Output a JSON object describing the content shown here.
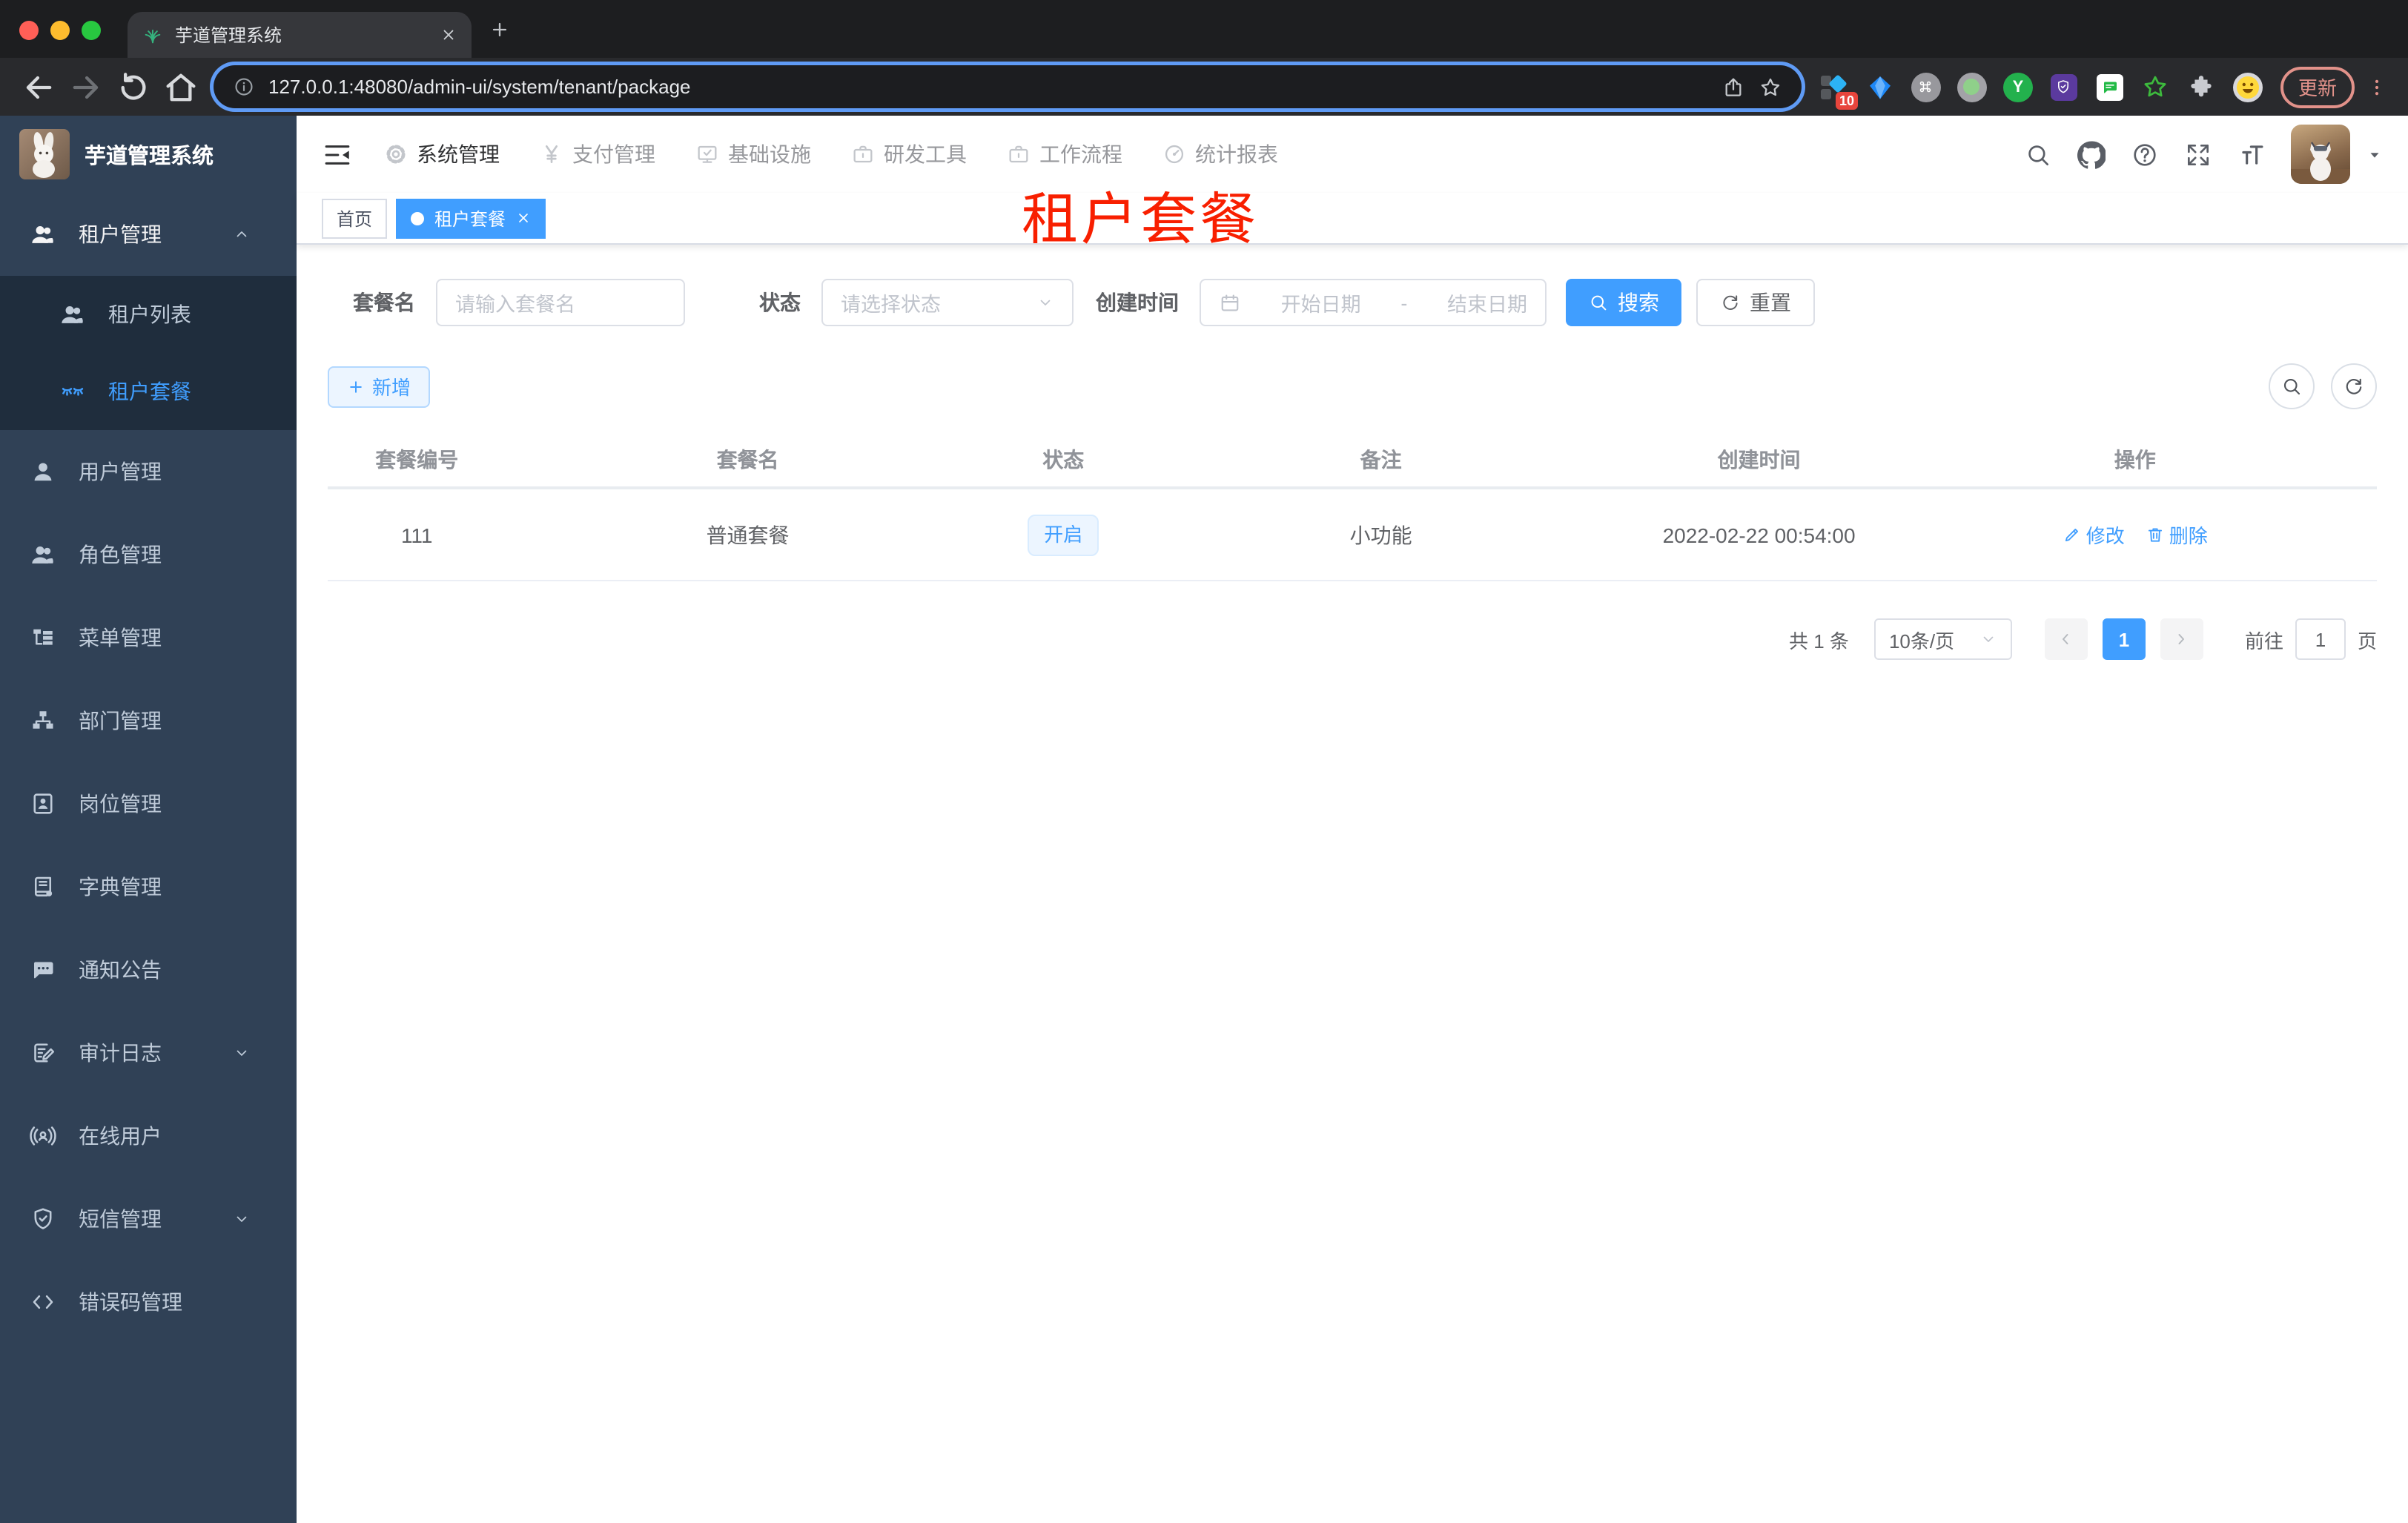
{
  "browser": {
    "tab_title": "芋道管理系统",
    "url": "127.0.0.1:48080/admin-ui/system/tenant/package",
    "update_label": "更新",
    "extension_badge": "10",
    "ext_y_label": "Y",
    "extensions": [
      "tampermonkey",
      "gem",
      "command",
      "recorder",
      "y-browser",
      "privacy-shield",
      "chat-notes",
      "star",
      "puzzle",
      "emoji"
    ]
  },
  "topnav": {
    "items": [
      {
        "label": "系统管理",
        "icon": "gear",
        "active": true
      },
      {
        "label": "支付管理",
        "icon": "yen",
        "active": false
      },
      {
        "label": "基础设施",
        "icon": "monitor",
        "active": false
      },
      {
        "label": "研发工具",
        "icon": "briefcase",
        "active": false
      },
      {
        "label": "工作流程",
        "icon": "briefcase",
        "active": false
      },
      {
        "label": "统计报表",
        "icon": "dashboard",
        "active": false
      }
    ]
  },
  "sidebar": {
    "app_title": "芋道管理系统",
    "menu": [
      {
        "label": "租户管理",
        "icon": "users",
        "chevron": "up",
        "open": true,
        "children": [
          {
            "label": "租户列表",
            "icon": "users",
            "active": false
          },
          {
            "label": "租户套餐",
            "icon": "lashes",
            "active": true
          }
        ]
      },
      {
        "label": "用户管理",
        "icon": "user"
      },
      {
        "label": "角色管理",
        "icon": "users"
      },
      {
        "label": "菜单管理",
        "icon": "tree"
      },
      {
        "label": "部门管理",
        "icon": "org"
      },
      {
        "label": "岗位管理",
        "icon": "badge"
      },
      {
        "label": "字典管理",
        "icon": "book"
      },
      {
        "label": "通知公告",
        "icon": "message"
      },
      {
        "label": "审计日志",
        "icon": "editlog",
        "chevron": "down"
      },
      {
        "label": "在线用户",
        "icon": "online"
      },
      {
        "label": "短信管理",
        "icon": "shield",
        "chevron": "down"
      },
      {
        "label": "错误码管理",
        "icon": "code"
      }
    ]
  },
  "tags": [
    {
      "label": "首页",
      "active": false,
      "closable": false
    },
    {
      "label": "租户套餐",
      "active": true,
      "closable": true
    }
  ],
  "overlay_title": "租户套餐",
  "filters": {
    "name_label": "套餐名",
    "name_placeholder": "请输入套餐名",
    "status_label": "状态",
    "status_placeholder": "请选择状态",
    "date_label": "创建时间",
    "date_start_placeholder": "开始日期",
    "date_separator": "-",
    "date_end_placeholder": "结束日期",
    "search_label": "搜索",
    "reset_label": "重置"
  },
  "toolbar": {
    "add_label": "新增"
  },
  "table": {
    "columns": [
      "套餐编号",
      "套餐名",
      "状态",
      "备注",
      "创建时间",
      "操作"
    ],
    "rows": [
      {
        "id": "111",
        "name": "普通套餐",
        "status": "开启",
        "remark": "小功能",
        "created": "2022-02-22 00:54:00",
        "edit": "修改",
        "delete": "删除"
      }
    ]
  },
  "pagination": {
    "total": "共 1 条",
    "page_size": "10条/页",
    "current": "1",
    "goto_label": "前往",
    "goto_value": "1",
    "unit_label": "页"
  },
  "colors": {
    "accent": "#409eff",
    "sidebar_bg": "#304156",
    "submenu_bg": "#1f2d3d",
    "sidebar_text": "#bfcbd9",
    "overlay_red": "#f81f00",
    "status_tag_bg": "#ecf5ff",
    "status_tag_border": "#d9ecff"
  }
}
